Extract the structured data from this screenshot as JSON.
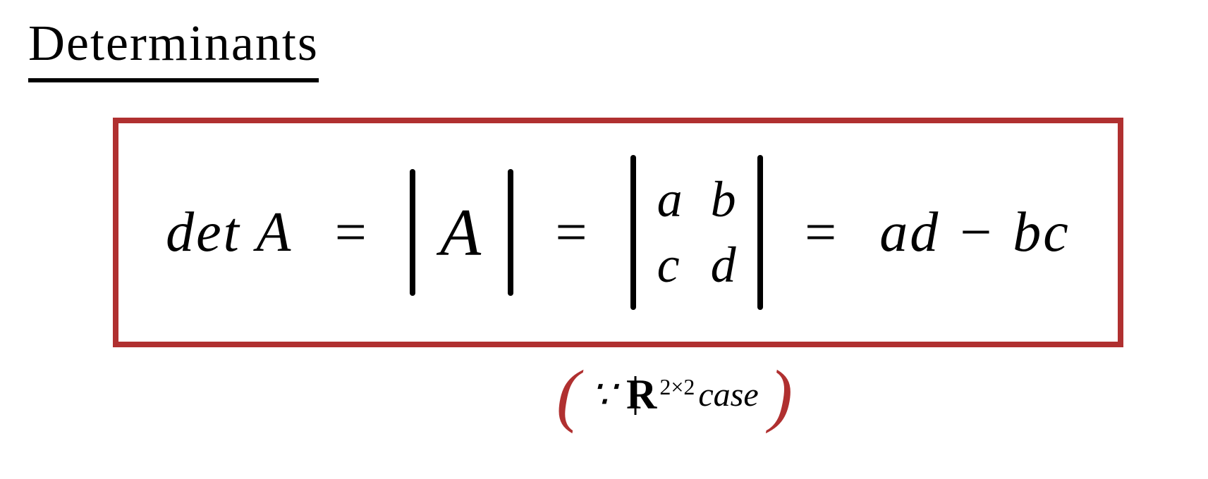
{
  "title": "Determinants",
  "formula": {
    "det_label": "det A",
    "equals1": "=",
    "abs_A": "A",
    "equals2": "=",
    "matrix": {
      "a": "a",
      "b": "b",
      "c": "c",
      "d": "d"
    },
    "equals3": "=",
    "result": "ad − bc"
  },
  "annotation": {
    "because": "∵",
    "real": "R",
    "exponent": "2×2",
    "case": "case"
  }
}
